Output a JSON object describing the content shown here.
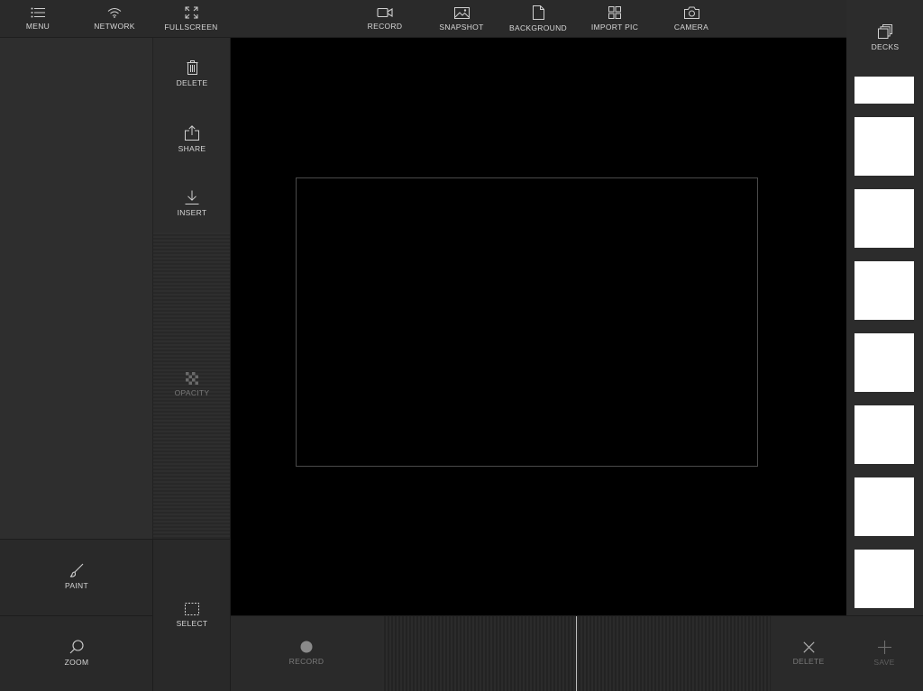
{
  "topbar_left": {
    "menu_label": "MENU",
    "network_label": "NETWORK",
    "fullscreen_label": "FULLSCREEN"
  },
  "topbar_center": {
    "record_label": "RECORD",
    "snapshot_label": "SNAPSHOT",
    "background_label": "BACKGROUND",
    "import_pic_label": "IMPORT PIC",
    "camera_label": "CAMERA"
  },
  "tools": {
    "delete_label": "DELETE",
    "share_label": "SHARE",
    "insert_label": "INSERT",
    "opacity_label": "OPACITY"
  },
  "bottom_left": {
    "paint_label": "PAINT",
    "zoom_label": "ZOOM",
    "select_label": "SELECT"
  },
  "bottom_bar": {
    "record_label": "RECORD",
    "delete_label": "DELETE",
    "save_label": "SAVE"
  },
  "decks": {
    "label": "DECKS",
    "thumbnail_count": 8
  },
  "colors": {
    "panel": "#2a2a2a",
    "canvas": "#000000",
    "thumbnail": "#ffffff",
    "text": "#d6d6d6",
    "disabled_text": "#7a7a7a"
  }
}
